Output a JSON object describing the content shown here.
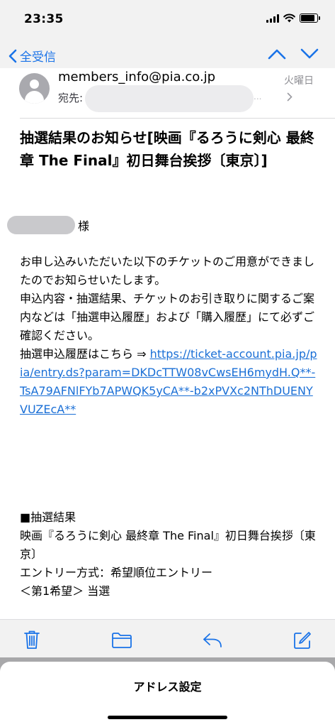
{
  "status_bar": {
    "time": "23:35"
  },
  "nav": {
    "back_label": "全受信"
  },
  "message": {
    "sender": "members_info@pia.co.jp",
    "day": "火曜日",
    "to_label": "宛先:",
    "to_tail": "...",
    "subject": "抽選結果のお知らせ[映画『るろうに剣心 最終章 The Final』初日舞台挨拶〔東京〕]",
    "honorific": "様",
    "body_line1": "お申し込みいただいた以下のチケットのご用意ができましたのでお知らせいたします。",
    "body_line2": "申込内容・抽選結果、チケットのお引き取りに関するご案内などは「抽選申込履歴」および「購入履歴」にて必ずご確認ください。",
    "history_prefix": "抽選申込履歴はこちら ⇒ ",
    "history_link": "https://ticket-account.pia.jp/pia/entry.ds?param=DKDcTTW08vCwsEH6mydH.Q**-TsA79AFNlFYb7APWQK5yCA**-b2xPVXc2NThDUENYVUZEcA**",
    "result_heading": "■抽選結果",
    "result_event": "映画『るろうに剣心 最終章 The Final』初日舞台挨拶〔東京〕",
    "result_entry": "エントリー方式：希望順位エントリー",
    "result_choice": "＜第1希望＞ 当選"
  },
  "toolbar": {
    "icons": [
      "trash-icon",
      "folder-icon",
      "reply-icon",
      "compose-icon"
    ]
  },
  "sheet": {
    "button_label": "アドレス設定"
  },
  "colors": {
    "accent": "#1a73e8",
    "link": "#1a6fd6",
    "bar_bg": "#f2f2f2"
  }
}
